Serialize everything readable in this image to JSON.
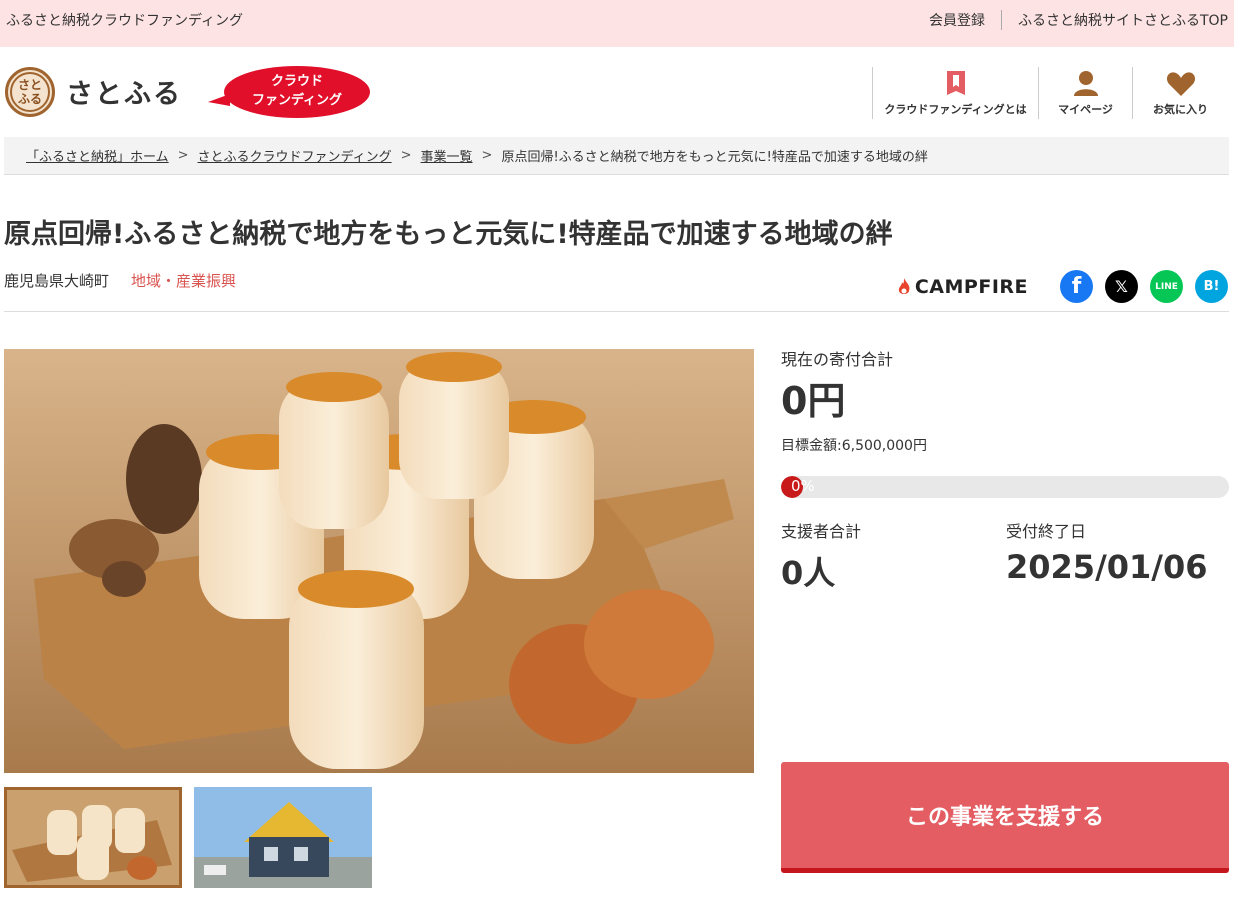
{
  "topbar": {
    "site_name": "ふるさと納税クラウドファンディング",
    "register_link": "会員登録",
    "top_link": "ふるさと納税サイトさとふるTOP"
  },
  "header": {
    "logo_text": "さとふる",
    "logo_mark": "さとふる",
    "badge_line1": "クラウド",
    "badge_line2": "ファンディング",
    "nav": [
      {
        "label": "クラウドファンディングとは",
        "icon": "book-icon"
      },
      {
        "label": "マイページ",
        "icon": "user-icon"
      },
      {
        "label": "お気に入り",
        "icon": "heart-icon"
      }
    ],
    "accent_color": "#a0642e"
  },
  "breadcrumb": [
    "「ふるさと納税」ホーム",
    "さとふるクラウドファンディング",
    "事業一覧",
    "原点回帰!ふるさと納税で地方をもっと元気に!特産品で加速する地域の絆"
  ],
  "project": {
    "title": "原点回帰!ふるさと納税で地方をもっと元気に!特産品で加速する地域の絆",
    "location": "鹿児島県大崎町",
    "category": "地域・産業振興",
    "partner": "CAMPFIRE"
  },
  "share": [
    {
      "name": "facebook",
      "glyph": "f",
      "color": "#1877f2"
    },
    {
      "name": "x",
      "glyph": "𝕏",
      "color": "#000000"
    },
    {
      "name": "line",
      "glyph": "LINE",
      "color": "#06c755"
    },
    {
      "name": "hatena",
      "glyph": "B!",
      "color": "#00a4de"
    }
  ],
  "stats": {
    "current_label": "現在の寄付合計",
    "current_value": "0円",
    "goal_text": "目標金額:6,500,000円",
    "progress_text": "0%",
    "progress_fraction": 0,
    "supporters_label": "支援者合計",
    "supporters_value": "0人",
    "deadline_label": "受付終了日",
    "deadline_value": "2025/01/06"
  },
  "cta_label": "この事業を支援する",
  "colors": {
    "topbar_bg": "#fde3e4",
    "cta": "#e35d62",
    "category": "#d9534f",
    "progress": "#c81a1a"
  }
}
